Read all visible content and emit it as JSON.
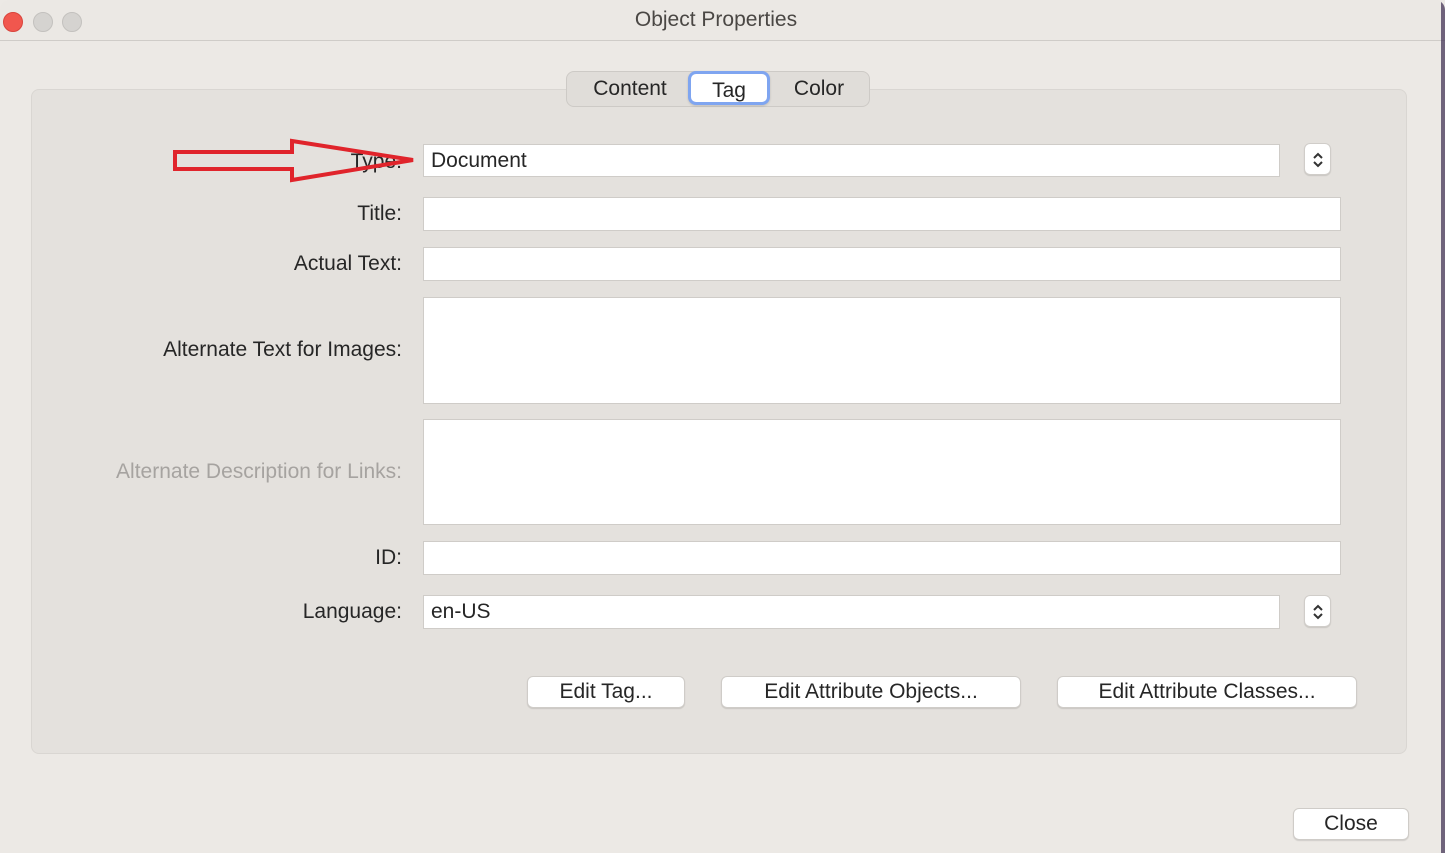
{
  "window": {
    "title": "Object Properties"
  },
  "tabs": [
    {
      "label": "Content",
      "selected": false
    },
    {
      "label": "Tag",
      "selected": true
    },
    {
      "label": "Color",
      "selected": false
    }
  ],
  "form": {
    "type_label": "Type:",
    "type_value": "Document",
    "title_label": "Title:",
    "title_value": "",
    "actual_text_label": "Actual Text:",
    "actual_text_value": "",
    "alt_images_label": "Alternate Text for Images:",
    "alt_images_value": "",
    "alt_links_label": "Alternate Description for Links:",
    "alt_links_value": "",
    "id_label": "ID:",
    "id_value": "",
    "language_label": "Language:",
    "language_value": "en-US"
  },
  "buttons": {
    "edit_tag": "Edit Tag...",
    "edit_attribute_objects": "Edit Attribute Objects...",
    "edit_attribute_classes": "Edit Attribute Classes...",
    "close": "Close"
  },
  "annotation": {
    "arrow_color": "#e0242b"
  },
  "icons": {
    "stepper": "up-down-chevron-icon"
  }
}
